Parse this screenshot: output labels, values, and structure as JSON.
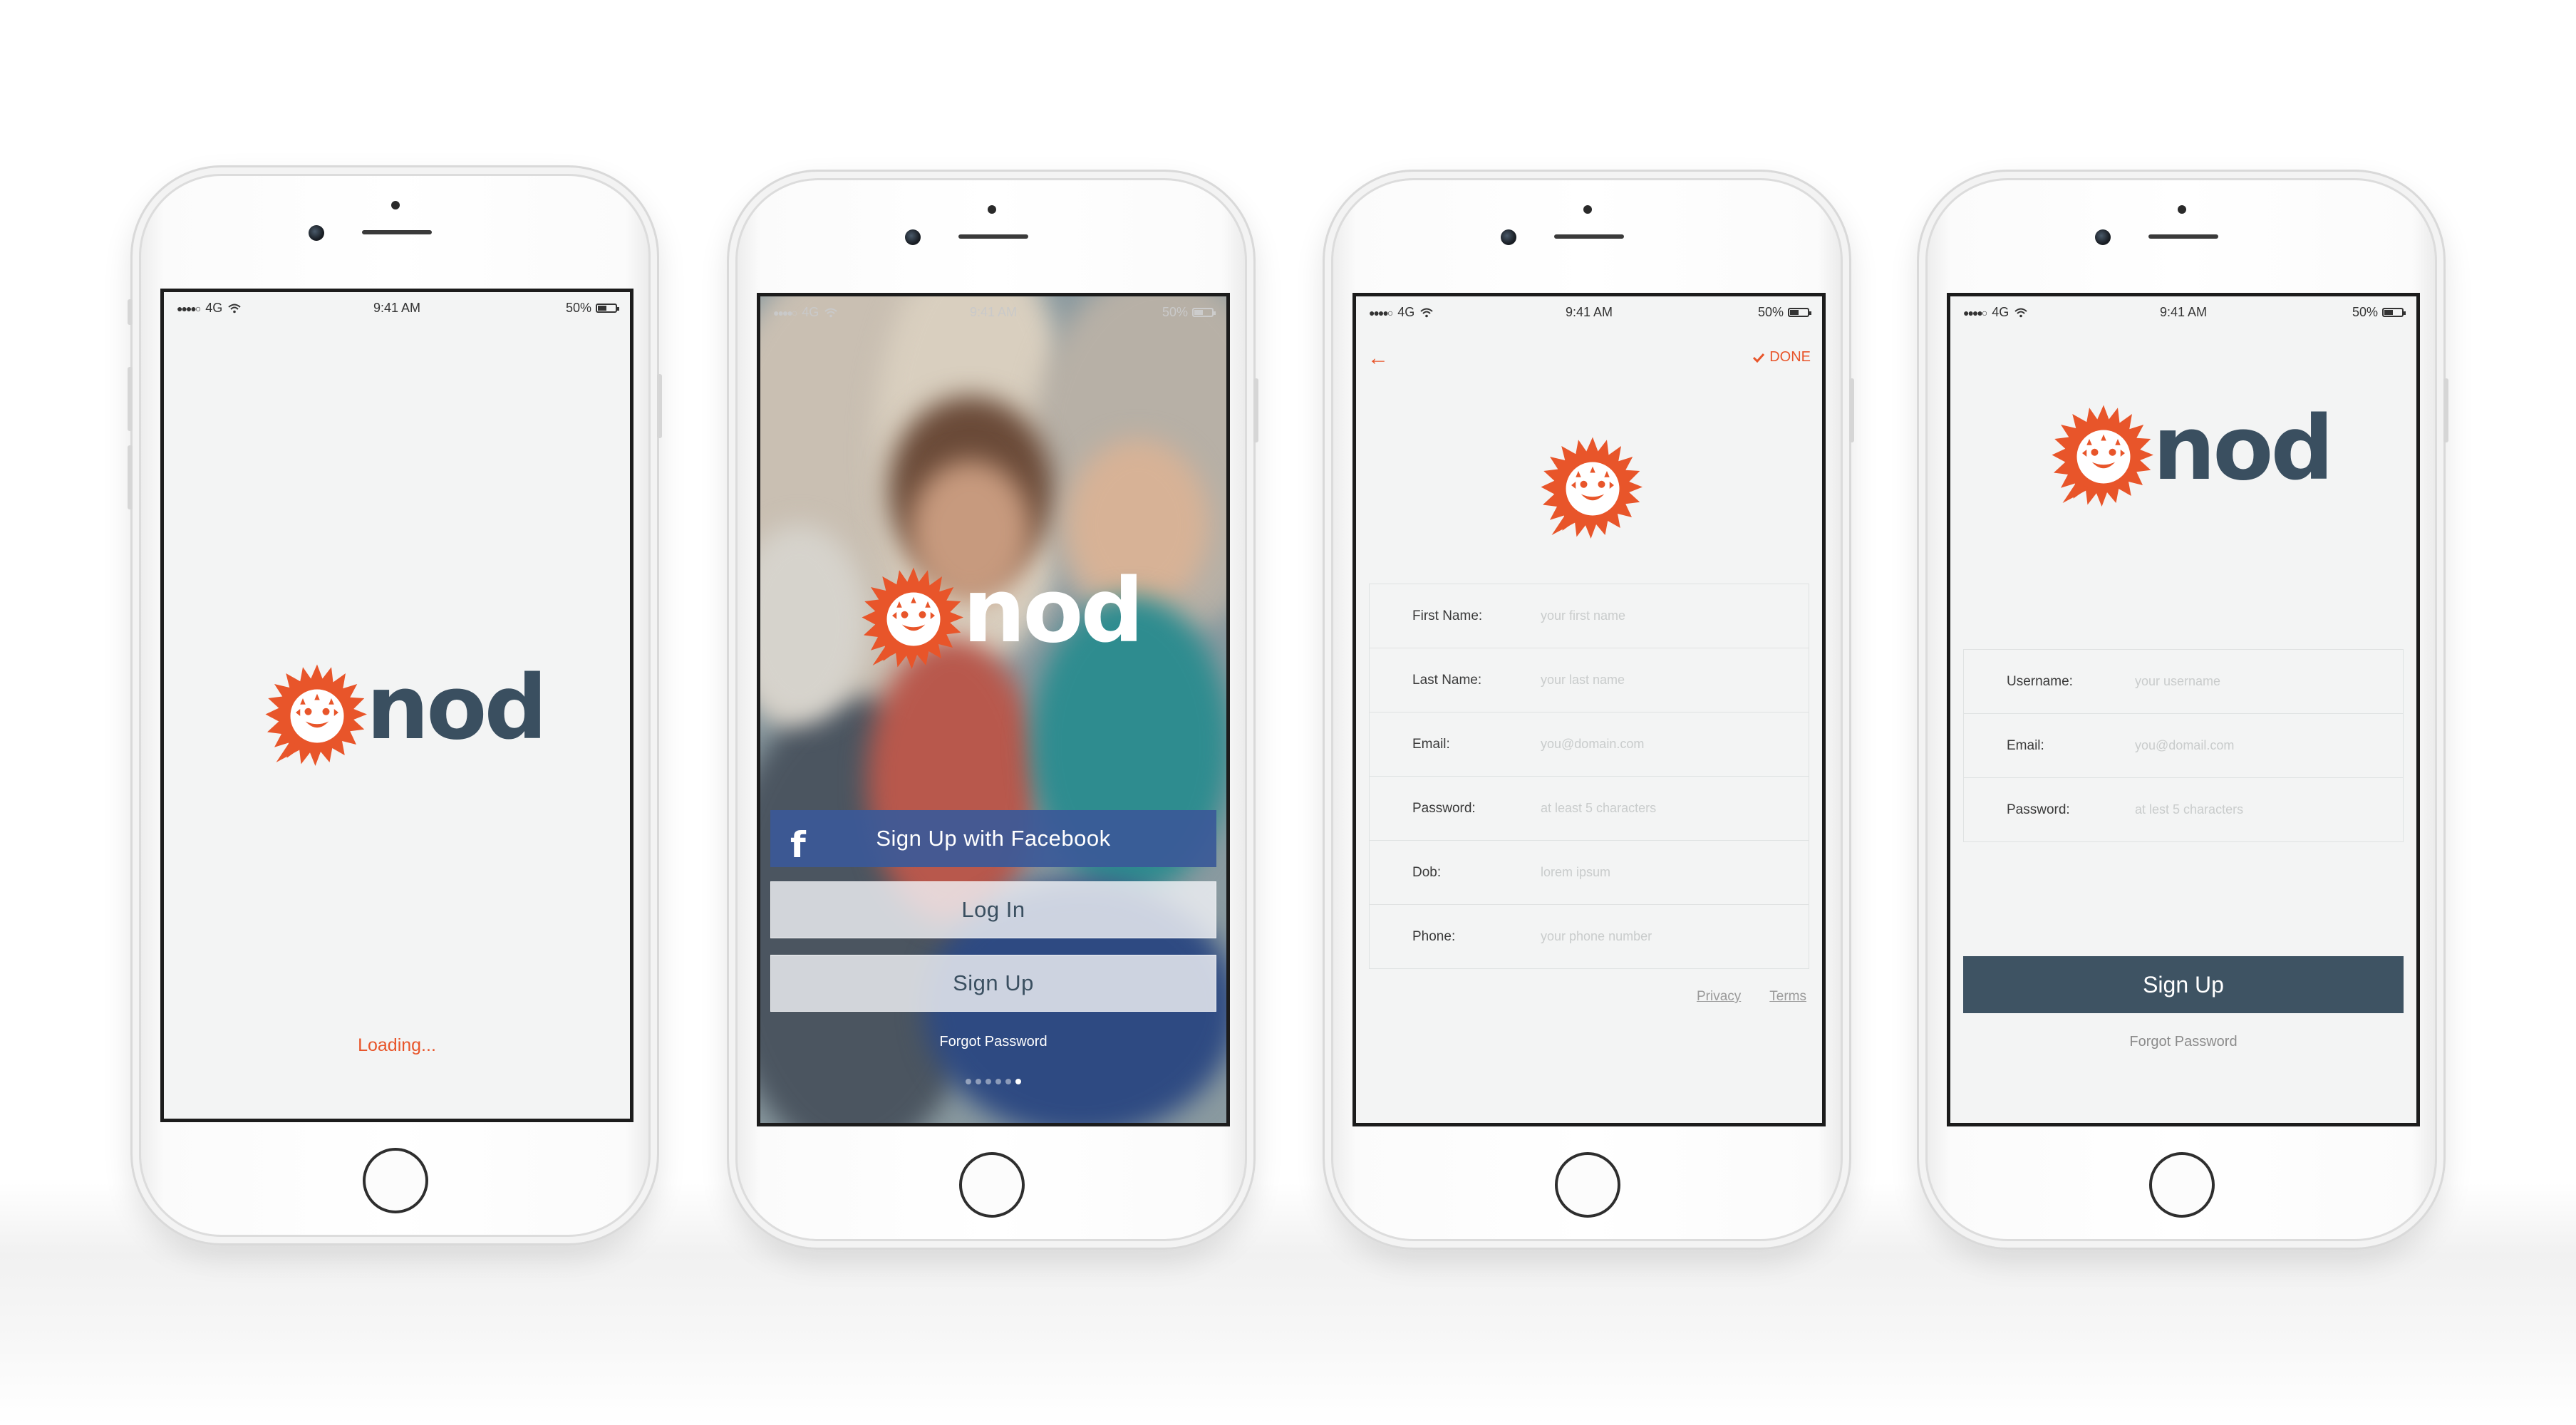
{
  "status_bar": {
    "carrier_dots": "●●●●○",
    "network": "4G",
    "time": "9:41 AM",
    "battery": "50%"
  },
  "brand": {
    "name": "nod",
    "accent_color": "#e8552a",
    "text_color": "#3a4f60"
  },
  "screen1": {
    "loading_text": "Loading..."
  },
  "screen2": {
    "facebook_button": "Sign Up with Facebook",
    "facebook_icon_letter": "f",
    "login_button": "Log In",
    "signup_button": "Sign Up",
    "forgot_password": "Forgot Password",
    "pager_count": 6,
    "pager_active_index": 5
  },
  "screen3": {
    "back_icon": "←",
    "done_label": "DONE",
    "fields": [
      {
        "label": "First Name:",
        "placeholder": "your first name"
      },
      {
        "label": "Last Name:",
        "placeholder": "your last name"
      },
      {
        "label": "Email:",
        "placeholder": "you@domain.com"
      },
      {
        "label": "Password:",
        "placeholder": "at least 5 characters"
      },
      {
        "label": "Dob:",
        "placeholder": "lorem ipsum"
      },
      {
        "label": "Phone:",
        "placeholder": "your phone number"
      }
    ],
    "privacy_link": "Privacy",
    "terms_link": "Terms"
  },
  "screen4": {
    "fields": [
      {
        "label": "Username:",
        "placeholder": "your username"
      },
      {
        "label": "Email:",
        "placeholder": "you@domail.com"
      },
      {
        "label": "Password:",
        "placeholder": "at lest 5 characters"
      }
    ],
    "signup_button": "Sign Up",
    "forgot_password": "Forgot Password"
  }
}
